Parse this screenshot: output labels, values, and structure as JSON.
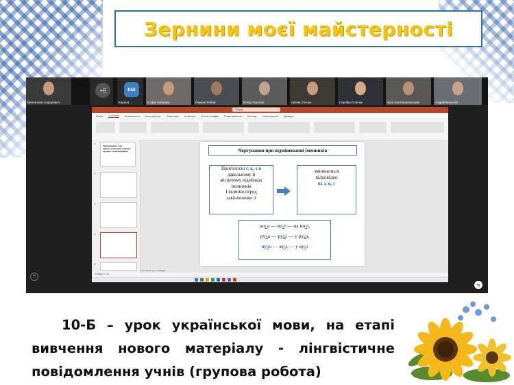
{
  "header": {
    "title": "Зернини моєї майстерності"
  },
  "meeting": {
    "participants": [
      {
        "name": "Валентина Сидорович"
      },
      {
        "name": "+6"
      },
      {
        "name": "Карина ...",
        "initials": "КШ"
      },
      {
        "name": "Софія Кобилюк"
      },
      {
        "name": "Герман Рябий"
      },
      {
        "name": "Влад Парасюк"
      },
      {
        "name": "Артем Сенчук"
      },
      {
        "name": "Сергійко Сенчук"
      },
      {
        "name": "Ярослав Кашковський"
      },
      {
        "name": "Андрій Безногій"
      }
    ],
    "record_icon": "S",
    "share_icon": "⇆"
  },
  "powerpoint": {
    "search_placeholder": "Пошук",
    "menu": [
      "Файл",
      "Основне",
      "Вставлення",
      "Конструктор",
      "Переходи",
      "Анімація",
      "Показ слайдів",
      "Рецензування",
      "Вигляд",
      "Записування",
      "Довідка"
    ],
    "active_menu": "Основне",
    "notes_placeholder": "Нотатки до слайда",
    "status_left": "Слайд 4 з 10",
    "thumbnails": [
      {
        "num": "1",
        "text": "Чергування ї з/зи приголосних при змінах у процесі словотворення."
      },
      {
        "num": "2"
      },
      {
        "num": "3"
      },
      {
        "num": "4"
      },
      {
        "num": "5"
      }
    ]
  },
  "slide": {
    "heading": "Чергування при відмінюванні іменників",
    "left_box": {
      "l1": "Приголосні ",
      "l1_hl": "г, к, х",
      "l1_end": " в",
      "l2": "давальному й",
      "l3": "місцевому відмінках",
      "l4": "іменників",
      "l5": "I відміни перед",
      "l6": "закінченням ",
      "l6_hl": "-і"
    },
    "right_box": {
      "l1": "змінюються",
      "l2": "відповідно",
      "l3": "на ",
      "l3_hl": "з, ц, с"
    },
    "examples": [
      {
        "a": "но",
        "a_u": "г",
        "a2": "а — но",
        "b_u": "з",
        "b2": "і — на но",
        "c_u": "з",
        "c2": "і,"
      },
      {
        "a": "ру",
        "a_u": "к",
        "a2": "а — ру",
        "b_u": "ц",
        "b2": "і — у ру",
        "c_u": "ц",
        "c2": "і,"
      },
      {
        "a": "ву",
        "a_u": "х",
        "a2": "о — ву",
        "b_u": "с",
        "b2": "і — у ву",
        "c_u": "с",
        "c2": "і"
      }
    ]
  },
  "caption": {
    "line1": "10-Б – урок української мови, на етапі",
    "line2": "вивчення нового матеріалу - лінгвістичне",
    "line3": "повідомлення  учнів (групова робота)"
  },
  "colors": {
    "title_yellow": "#f5c515",
    "frame_blue": "#2d6fb3",
    "ppt_red": "#b7472a",
    "accent_blue": "#2b6cc4"
  }
}
